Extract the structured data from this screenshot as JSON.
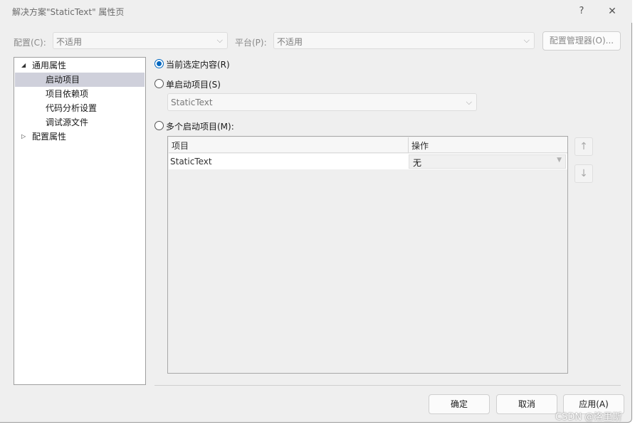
{
  "window": {
    "title": "解决方案\"StaticText\" 属性页",
    "help_glyph": "?",
    "close_glyph": "✕"
  },
  "toolbar": {
    "config_label": "配置(C):",
    "config_value": "不适用",
    "platform_label": "平台(P):",
    "platform_value": "不适用",
    "config_manager_label": "配置管理器(O)..."
  },
  "tree": {
    "items": [
      {
        "label": "通用属性",
        "expanded": true
      },
      {
        "label": "启动项目",
        "selected": true
      },
      {
        "label": "项目依赖项"
      },
      {
        "label": "代码分析设置"
      },
      {
        "label": "调试源文件"
      },
      {
        "label": "配置属性",
        "expanded": false
      }
    ]
  },
  "startup": {
    "option_current": "当前选定内容(R)",
    "option_single": "单启动项目(S)",
    "single_value": "StaticText",
    "option_multiple": "多个启动项目(M):",
    "selected_option": "current"
  },
  "grid": {
    "col_project": "项目",
    "col_action": "操作",
    "rows": [
      {
        "project": "StaticText",
        "action": "无"
      }
    ]
  },
  "arrows": {
    "up": "↑",
    "down": "↓"
  },
  "footer": {
    "ok_label": "确定",
    "cancel_label": "取消",
    "apply_label": "应用(A)"
  },
  "watermark": "CSDN @洛里斯",
  "colors": {
    "accent": "#0067c0",
    "selection": "#cfd0db",
    "dialog_bg": "#efefef"
  }
}
